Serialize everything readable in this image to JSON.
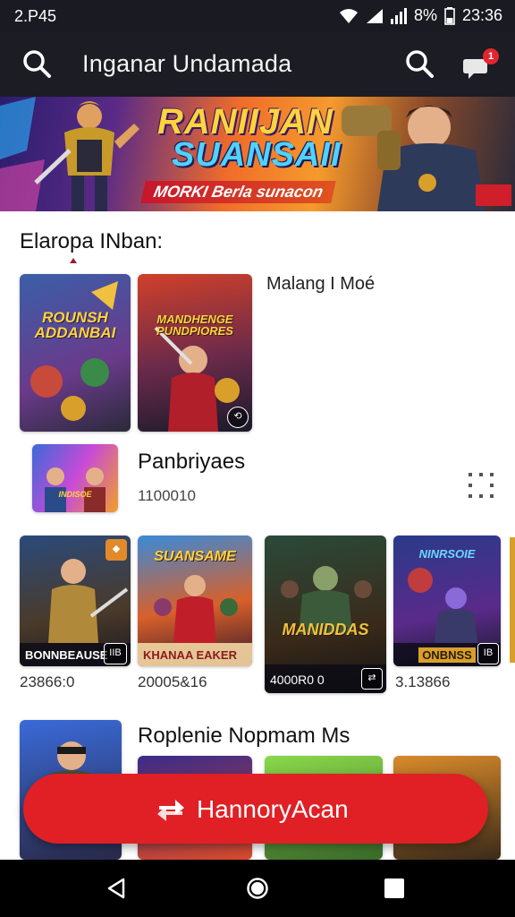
{
  "status_bar": {
    "time_left": "2.P45",
    "battery": "8%",
    "time_right": "23:36"
  },
  "app_bar": {
    "title": "Inganar Undamada",
    "notification_count": "1"
  },
  "hero": {
    "title_line1": "RANIIJAN",
    "title_line2": "SUANSAII",
    "tagline": "MORKI Berla sunacon"
  },
  "section1": {
    "title": "Elaropa INban:",
    "side_label": "Malang I Moé",
    "cards": [
      {
        "title": "ROUNSH ADDANBAI"
      },
      {
        "title": "MANDHENGE PUNDPIORES"
      }
    ]
  },
  "featured": {
    "title": "Panbriyaes",
    "value": "1100010",
    "thumb_title": "INDISOE"
  },
  "row3": {
    "cards": [
      {
        "footer": "BONNBEAUSE",
        "chip": "IIB",
        "value": "23866:0"
      },
      {
        "title": "SUANSAME",
        "footer": "KHANAA EAKER",
        "value": "20005&16"
      },
      {
        "title": "MANIDDAS",
        "footer": "4000R0 0",
        "value": ""
      },
      {
        "title": "NINRSOIE",
        "footer": "ONBNSS",
        "chip": "IB",
        "value": "3.13866"
      }
    ]
  },
  "section2": {
    "title": "Roplenie Nopmam Ms"
  },
  "cta": {
    "label": "HannoryAcan"
  },
  "colors": {
    "accent": "#e02024",
    "appbar": "#1b1c24"
  }
}
